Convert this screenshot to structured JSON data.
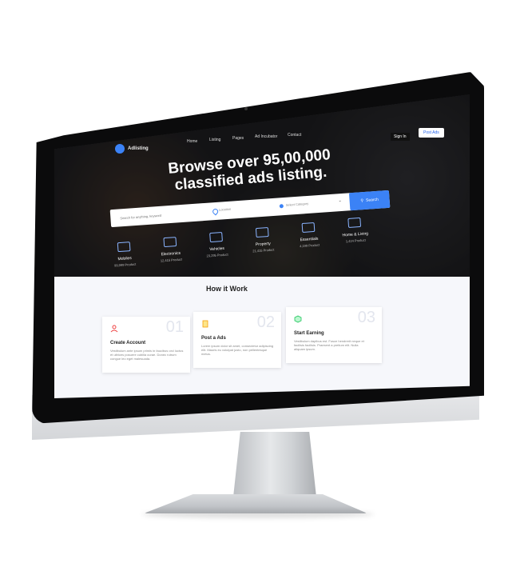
{
  "colors": {
    "accent": "#3b82f6",
    "hero_text": "#ffffff"
  },
  "nav": {
    "logo": "Adlisting",
    "items": [
      "Home",
      "Listing",
      "Pages",
      "Ad Incubator",
      "Contact"
    ],
    "sign_in": "Sign In",
    "post_ads": "Post Ads"
  },
  "hero": {
    "headline_line1": "Browse over 95,00,000",
    "headline_line2": "classified ads listing."
  },
  "search": {
    "placeholder": "Search for anything, keyword",
    "location": "Location",
    "category": "Select Category",
    "button": "Search"
  },
  "categories": [
    {
      "name": "Mobiles",
      "count": "99,999 Product",
      "icon": "mobile-icon"
    },
    {
      "name": "Electronics",
      "count": "12,415 Product",
      "icon": "monitor-icon"
    },
    {
      "name": "Vehicles",
      "count": "23,295 Product",
      "icon": "car-icon"
    },
    {
      "name": "Property",
      "count": "21,415 Product",
      "icon": "building-icon"
    },
    {
      "name": "Essentials",
      "count": "4,199 Product",
      "icon": "tools-icon"
    },
    {
      "name": "Home & Living",
      "count": "1,424 Product",
      "icon": "house-icon"
    }
  ],
  "how": {
    "title": "How it Work",
    "cards": [
      {
        "num": "01",
        "title": "Create Account",
        "text": "Vestibulum ante ipsum primis in faucibus orci luctus et ultrices posuere cubilia curae. Donec rutrum congue leo eget malesuada.",
        "icon": "user-icon"
      },
      {
        "num": "02",
        "title": "Post a Ads",
        "text": "Lorem ipsum dolor sit amet, consectetur adipiscing elit. Mauris eu volutpat justo, non pellentesque metus.",
        "icon": "clipboard-icon"
      },
      {
        "num": "03",
        "title": "Start Earning",
        "text": "Vestibulum dapibus est. Fusce hendrerit neque et facilisis facilisis. Praesent a pretium elit. Nulla aliquam ipsum.",
        "icon": "box-icon"
      }
    ]
  }
}
